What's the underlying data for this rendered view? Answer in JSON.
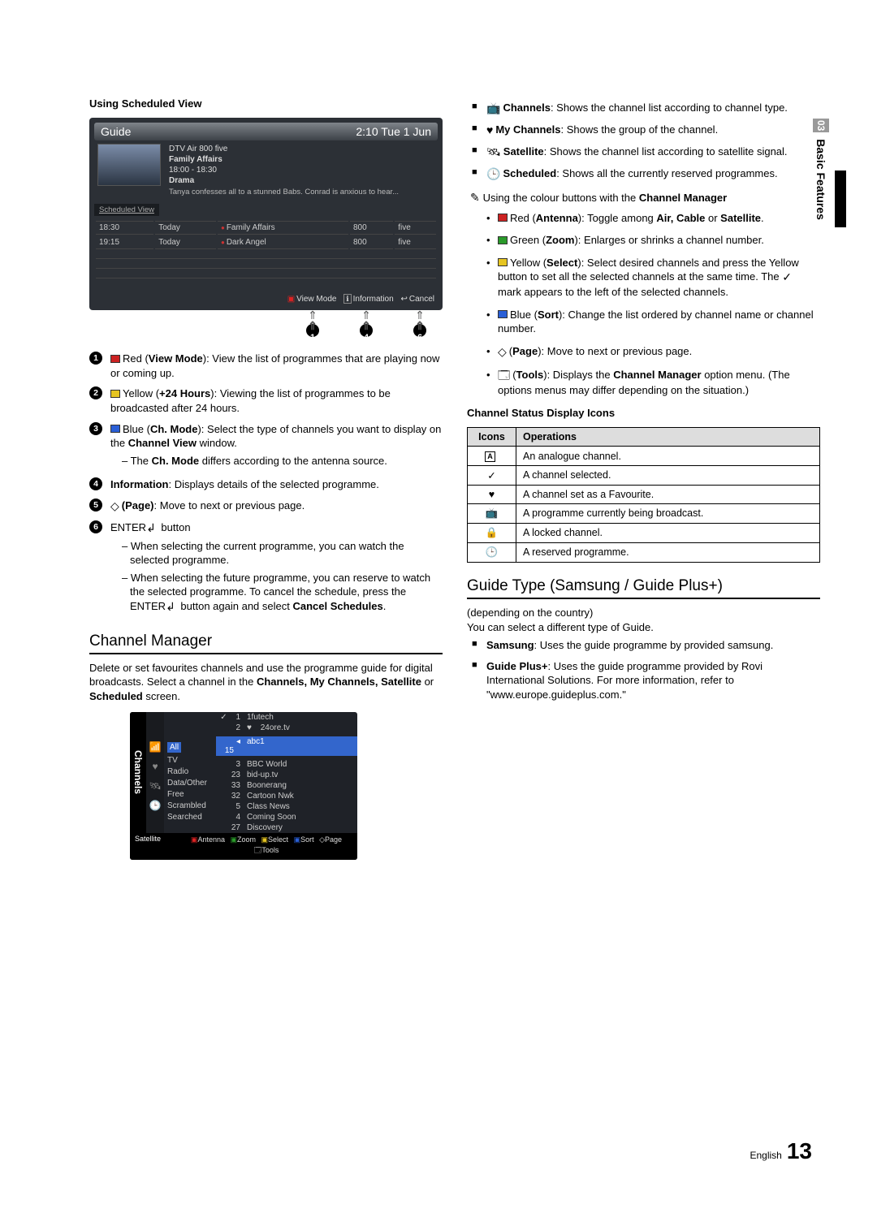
{
  "side_tab": {
    "num": "03",
    "label": "Basic Features"
  },
  "left": {
    "using_scheduled_view": "Using Scheduled View",
    "guide": {
      "title": "Guide",
      "time": "2:10 Tue 1 Jun",
      "meta_line1": "DTV Air 800 five",
      "meta_line2": "Family Affairs",
      "meta_line3": "18:00 - 18:30",
      "meta_line4": "Drama",
      "synopsis": "Tanya confesses all to a stunned Babs. Conrad is anxious to hear...",
      "tab_label": "Scheduled View",
      "rows": [
        {
          "time": "18:30",
          "day": "Today",
          "title": "Family Affairs",
          "num": "800",
          "ch": "five"
        },
        {
          "time": "19:15",
          "day": "Today",
          "title": "Dark Angel",
          "num": "800",
          "ch": "five"
        }
      ],
      "footer": {
        "view_mode": "View Mode",
        "info": "Information",
        "cancel": "Cancel"
      }
    },
    "callouts": [
      "1",
      "4",
      "6"
    ],
    "items": {
      "i1_label": "Red (",
      "i1_b": "View Mode",
      "i1_rest": "): View the list of programmes that are playing now or coming up.",
      "i2_label": "Yellow (",
      "i2_b": "+24 Hours",
      "i2_rest": "): Viewing the list of programmes to be broadcasted after 24 hours.",
      "i3_label": "Blue (",
      "i3_b": "Ch. Mode",
      "i3_rest": "): Select the type of channels you want to display on the ",
      "i3_b2": "Channel View",
      "i3_rest2": " window.",
      "i3_sub": "The ",
      "i3_sub_b": "Ch. Mode",
      "i3_sub_rest": " differs according to the antenna source.",
      "i4_b": "Information",
      "i4_rest": ": Displays details of the selected programme.",
      "i5_b": "(Page)",
      "i5_rest": ": Move to next or previous page.",
      "i6_pre": "ENTER",
      "i6_post": " button",
      "i6_sub1": "When selecting the current programme, you can watch the selected programme.",
      "i6_sub2_a": "When selecting the future programme, you can reserve to watch the selected programme. To cancel the schedule, press the ENTER",
      "i6_sub2_b": " button again and select ",
      "i6_sub2_c": "Cancel Schedules",
      "i6_sub2_d": "."
    },
    "cm_h2": "Channel Manager",
    "cm_p1": "Delete or set favourites channels and use the programme guide for digital broadcasts. Select a channel in the ",
    "cm_p1_b": "Channels, My Channels, Satellite",
    "cm_p1_mid": " or ",
    "cm_p1_b2": "Scheduled",
    "cm_p1_end": " screen.",
    "cm": {
      "side": "Channels",
      "filter_sel": "All",
      "filters": [
        "TV",
        "Radio",
        "Data/Other",
        "Free",
        "Scrambled",
        "Searched"
      ],
      "hdr1_num": "1",
      "hdr1_name": "1futech",
      "hdr2_num": "2",
      "hdr2_name": "24ore.tv",
      "sel_num": "15",
      "sel_name": "abc1",
      "rows": [
        {
          "n": "3",
          "name": "BBC World"
        },
        {
          "n": "23",
          "name": "bid-up.tv"
        },
        {
          "n": "33",
          "name": "Boonerang"
        },
        {
          "n": "32",
          "name": "Cartoon Nwk"
        },
        {
          "n": "5",
          "name": "Class News"
        },
        {
          "n": "4",
          "name": "Coming Soon"
        },
        {
          "n": "27",
          "name": "Discovery"
        }
      ],
      "sat": "Satellite",
      "foot": {
        "ant": "Antenna",
        "zoom": "Zoom",
        "sel": "Select",
        "sort": "Sort",
        "page": "Page",
        "tools": "Tools"
      }
    }
  },
  "right": {
    "sq": {
      "ch_b": "Channels",
      "ch_rest": ": Shows the channel list according to channel type.",
      "my_b": "My Channels",
      "my_rest": ": Shows the group of the channel.",
      "sat_b": "Satellite",
      "sat_rest": ": Shows the channel list according to satellite signal.",
      "sch_b": "Scheduled",
      "sch_rest": ": Shows all the currently reserved programmes."
    },
    "hand_a": "Using the colour buttons with the ",
    "hand_b": "Channel Manager",
    "dots": {
      "d1_a": "Red (",
      "d1_b": "Antenna",
      "d1_c": "): Toggle among ",
      "d1_d": "Air, Cable",
      "d1_e": " or ",
      "d1_f": "Satellite",
      "d1_g": ".",
      "d2_a": "Green (",
      "d2_b": "Zoom",
      "d2_c": "): Enlarges or shrinks a channel number.",
      "d3_a": "Yellow (",
      "d3_b": "Select",
      "d3_c": "): Select desired channels and press the Yellow button to set all the selected channels at the same time. The ",
      "d3_d": " mark appears to the left of the selected channels.",
      "d4_a": "Blue (",
      "d4_b": "Sort",
      "d4_c": "): Change the list ordered by channel name or channel number.",
      "d5_a": "(",
      "d5_b": "Page",
      "d5_c": "): Move to next or previous page.",
      "d6_a": "(",
      "d6_b": "Tools",
      "d6_c": "): Displays the ",
      "d6_d": "Channel Manager",
      "d6_e": " option menu. (The options menus may differ depending on the situation.)"
    },
    "status_title": "Channel Status Display Icons",
    "status_th1": "Icons",
    "status_th2": "Operations",
    "status_rows": [
      {
        "icon": "A",
        "op": "An analogue channel."
      },
      {
        "icon": "✓",
        "op": "A channel selected."
      },
      {
        "icon": "♥",
        "op": "A channel set as a Favourite."
      },
      {
        "icon": "📺",
        "op": "A programme currently being broadcast."
      },
      {
        "icon": "🔒",
        "op": "A locked channel."
      },
      {
        "icon": "🕒",
        "op": "A reserved programme."
      }
    ],
    "gt_h2": "Guide Type (Samsung / Guide Plus+)",
    "gt_p1": "(depending on the country)",
    "gt_p2": "You can select a different type of Guide.",
    "gt_s_b": "Samsung",
    "gt_s_rest": ": Uses the guide programme by provided samsung.",
    "gt_g_b": "Guide Plus+",
    "gt_g_rest": ": Uses the guide programme provided by Rovi International Solutions. For more information, refer to \"www.europe.guideplus.com.\""
  },
  "footer": {
    "lang": "English",
    "page": "13"
  }
}
